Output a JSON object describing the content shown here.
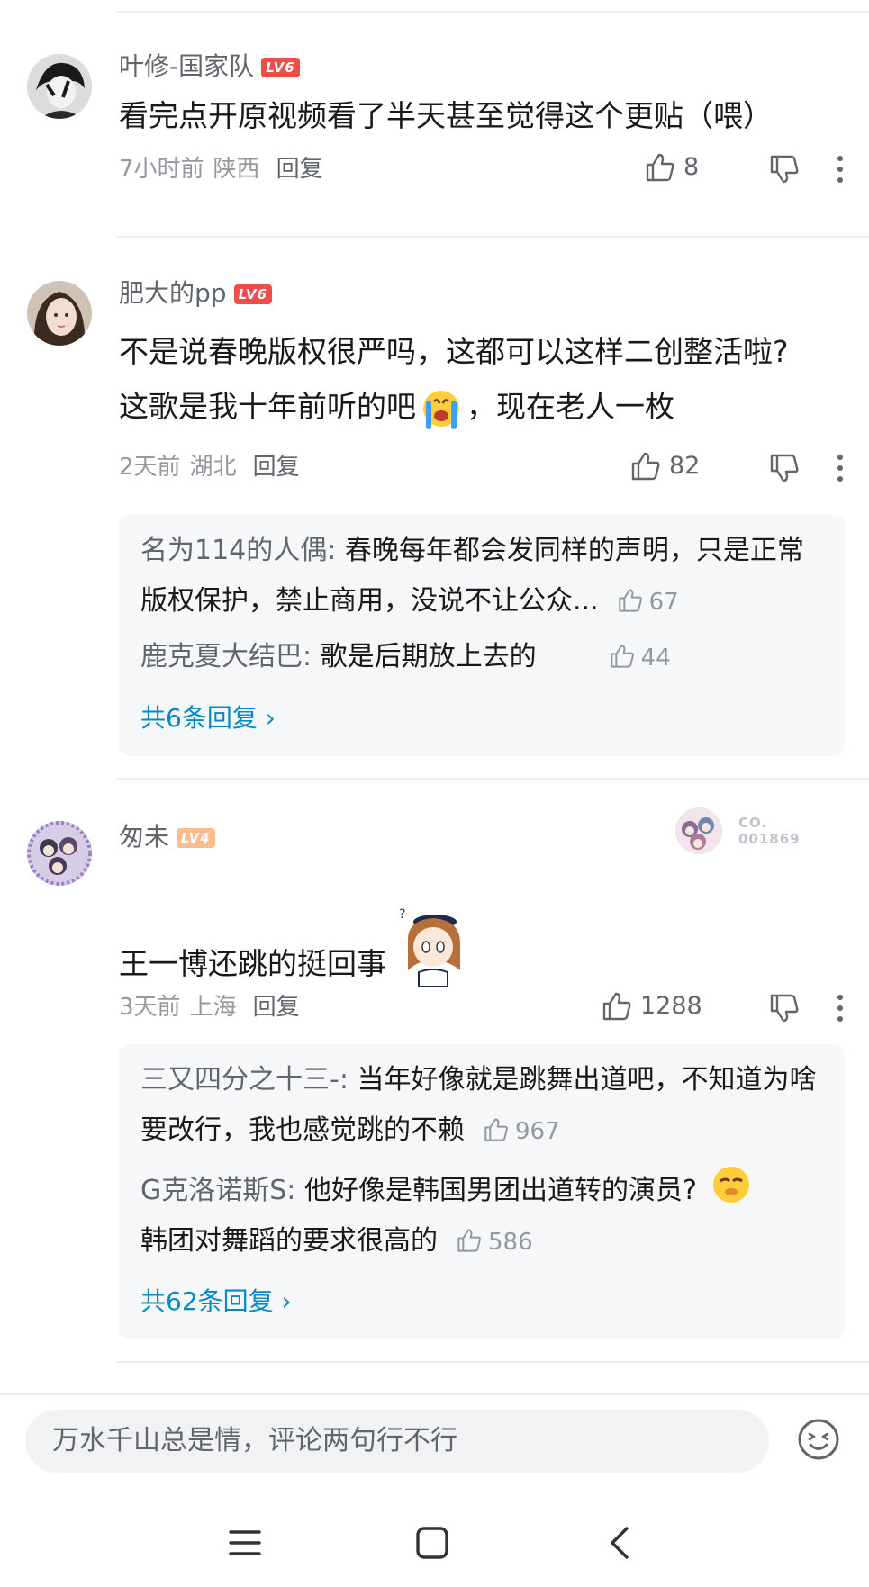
{
  "comments": [
    {
      "username": "叶修-国家队",
      "level": "LV6",
      "text": "看完点开原视频看了半天甚至觉得这个更贴（喂）",
      "time": "7小时前",
      "location": "陕西",
      "reply_label": "回复",
      "likes": "8"
    },
    {
      "username": "肥大的pp",
      "level": "LV6",
      "text_line1": "不是说春晚版权很严吗，这都可以这样二创整活啦?",
      "text_line2a": "这歌是我十年前听的吧",
      "text_line2b": "，现在老人一枚",
      "time": "2天前",
      "location": "湖北",
      "reply_label": "回复",
      "likes": "82",
      "replies": [
        {
          "who": "名为114的人偶:",
          "text": " 春晚每年都会发同样的声明，只是正常版权保护，禁止商用，没说不让公众...",
          "likes": "67"
        },
        {
          "who": "鹿克夏大结巴:",
          "text": " 歌是后期放上去的",
          "likes": "44"
        }
      ],
      "more_replies": "共6条回复"
    },
    {
      "username": "匆未",
      "level": "LV4",
      "badge_text": "CO. 001869",
      "text": "王一博还跳的挺回事",
      "time": "3天前",
      "location": "上海",
      "reply_label": "回复",
      "likes": "1288",
      "replies": [
        {
          "who": "三又四分之十三-:",
          "text": " 当年好像就是跳舞出道吧，不知道为啥要改行，我也感觉跳的不赖",
          "likes": "967"
        },
        {
          "who": "G克洛诺斯S:",
          "text_a": " 他好像是韩国男团出道转的演员?",
          "text_b": "韩团对舞蹈的要求很高的",
          "likes": "586"
        }
      ],
      "more_replies": "共62条回复"
    }
  ],
  "input": {
    "placeholder": "万水千山总是情，评论两句行不行"
  }
}
